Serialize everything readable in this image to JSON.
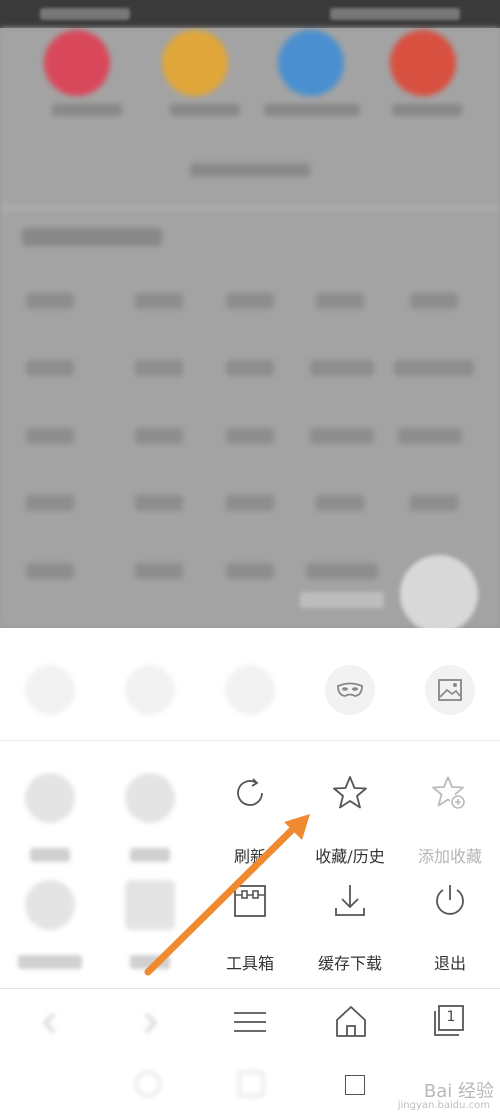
{
  "menu": {
    "refresh_label": "刷新",
    "favorites_history_label": "收藏/历史",
    "add_favorite_label": "添加收藏",
    "toolbox_label": "工具箱",
    "downloads_label": "缓存下载",
    "exit_label": "退出"
  },
  "nav": {
    "tabs_count": "1"
  },
  "watermark": {
    "text": "Bai 经验",
    "sub": "jingyan.baidu.com"
  },
  "colors": {
    "app_red": "#d9485a",
    "app_yellow": "#e0a63a",
    "app_blue": "#4a90d0",
    "app_orange_red": "#d85040",
    "arrow": "#f08a30"
  }
}
